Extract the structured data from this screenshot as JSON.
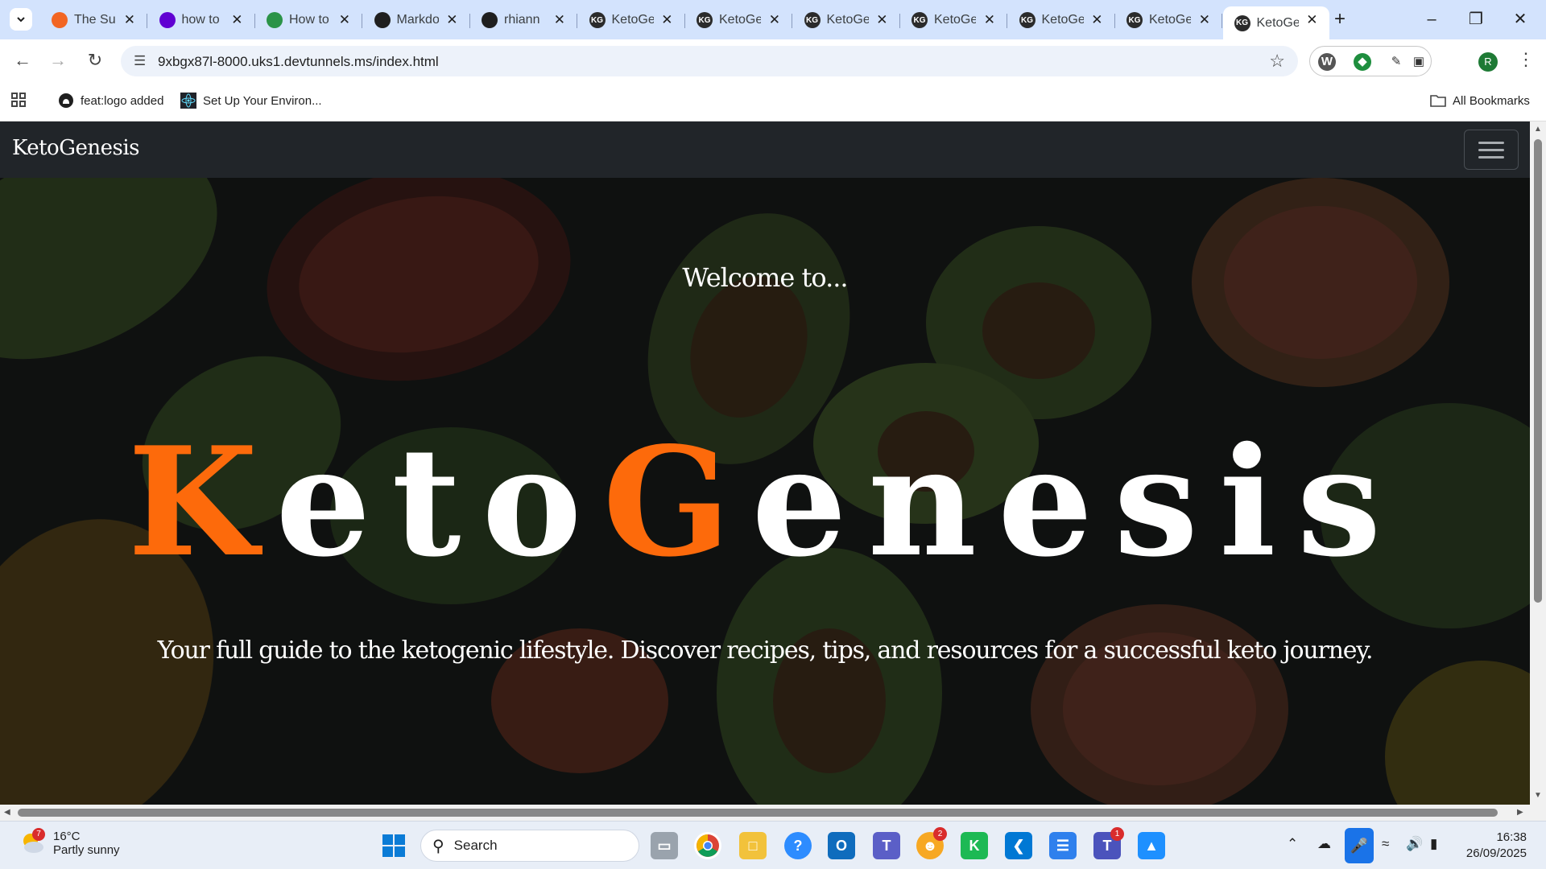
{
  "browser": {
    "tabs": [
      {
        "title": "The Su",
        "favicon_color": "#f26522"
      },
      {
        "title": "how to",
        "favicon_color": "#6001d2"
      },
      {
        "title": "How to",
        "favicon_color": "#2b9348"
      },
      {
        "title": "Markdo",
        "favicon_color": "#1f1f1f"
      },
      {
        "title": "rhiann",
        "favicon_color": "#1f1f1f"
      },
      {
        "title": "KetoGe",
        "favicon_color": "#2b2b2b"
      },
      {
        "title": "KetoGe",
        "favicon_color": "#2b2b2b"
      },
      {
        "title": "KetoGe",
        "favicon_color": "#2b2b2b"
      },
      {
        "title": "KetoGe",
        "favicon_color": "#2b2b2b"
      },
      {
        "title": "KetoGe",
        "favicon_color": "#2b2b2b"
      },
      {
        "title": "KetoGe",
        "favicon_color": "#2b2b2b"
      },
      {
        "title": "KetoGe",
        "favicon_color": "#2b2b2b"
      }
    ],
    "favicon_kg": "KG",
    "url": "9xbgx87l-8000.uks1.devtunnels.ms/index.html",
    "profile_initial": "R",
    "bookmarks": [
      {
        "label": "feat:logo added",
        "icon": "github-icon"
      },
      {
        "label": "Set Up Your Environ...",
        "icon": "react-icon"
      }
    ],
    "all_bookmarks": "All Bookmarks"
  },
  "site": {
    "brand": "KetoGenesis",
    "welcome": "Welcome to...",
    "title_parts": [
      "K",
      "eto",
      "G",
      "enesis"
    ],
    "tagline": "Your full guide to the ketogenic lifestyle. Discover recipes, tips, and resources for a successful keto journey.",
    "accent_color": "#fd6a0b",
    "nav_bg": "#212529"
  },
  "taskbar": {
    "weather_temp": "16°C",
    "weather_desc": "Partly sunny",
    "weather_badge": "7",
    "search_placeholder": "Search",
    "discord_badge": "2",
    "teams_badge": "1",
    "time": "16:38",
    "date": "26/09/2025"
  }
}
